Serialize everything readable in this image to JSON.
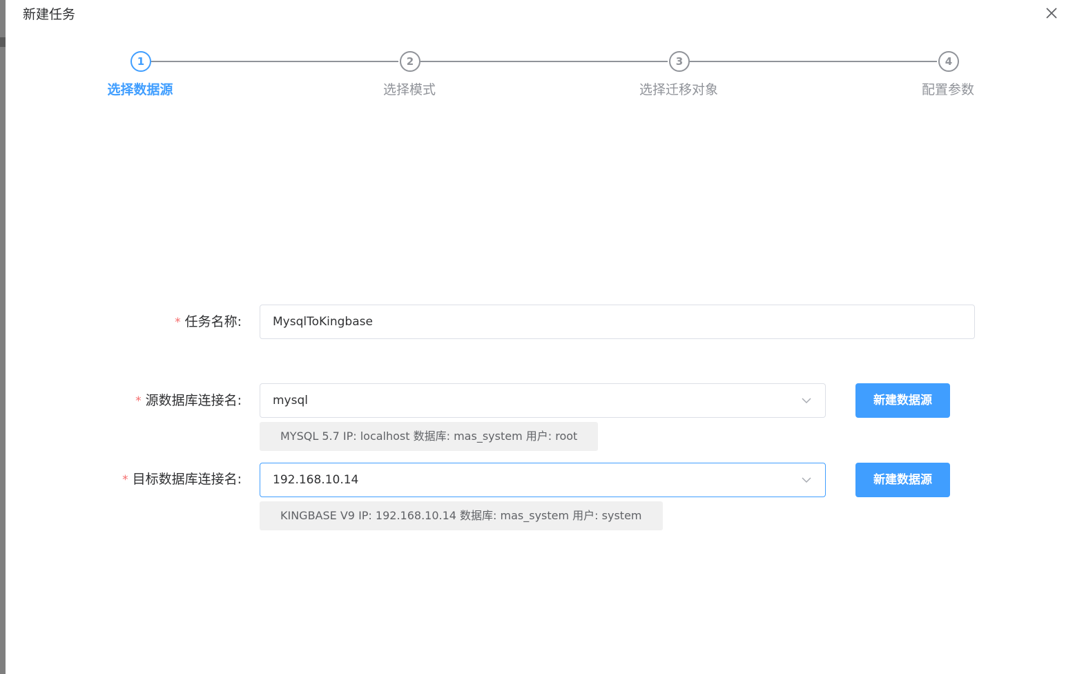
{
  "dialog": {
    "title": "新建任务"
  },
  "steps": [
    {
      "number": "1",
      "label": "选择数据源",
      "state": "active"
    },
    {
      "number": "2",
      "label": "选择模式",
      "state": "wait"
    },
    {
      "number": "3",
      "label": "选择迁移对象",
      "state": "wait"
    },
    {
      "number": "4",
      "label": "配置参数",
      "state": "wait"
    }
  ],
  "form": {
    "required_mark": "*",
    "task_name": {
      "label": "任务名称:",
      "value": "MysqlToKingbase"
    },
    "source": {
      "label": "源数据库连接名:",
      "value": "mysql",
      "info": "MYSQL 5.7 IP: localhost 数据库:  mas_system 用户: root",
      "button": "新建数据源"
    },
    "target": {
      "label": "目标数据库连接名:",
      "value": "192.168.10.14",
      "info": "KINGBASE V9 IP: 192.168.10.14 数据库:  mas_system 用户: system",
      "button": "新建数据源"
    }
  },
  "colors": {
    "primary": "#409eff",
    "required": "#f56c6c",
    "inactive": "#909399",
    "tag_background": "#f0f0f0"
  },
  "icons": {
    "close": "close-icon",
    "dropdown": "chevron-down-icon"
  }
}
